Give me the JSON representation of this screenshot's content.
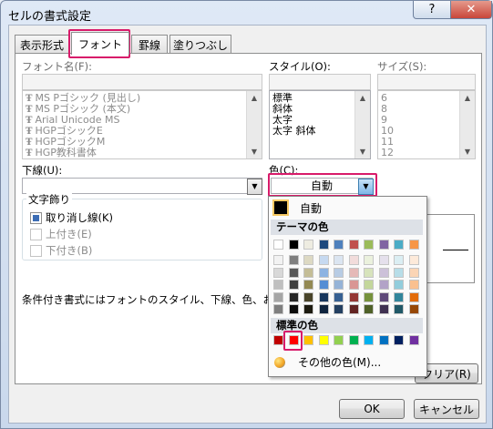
{
  "window": {
    "title": "セルの書式設定",
    "help": "?",
    "close": "✕"
  },
  "tabs": [
    {
      "label": "表示形式",
      "active": false
    },
    {
      "label": "フォント",
      "active": true
    },
    {
      "label": "罫線",
      "active": false
    },
    {
      "label": "塗りつぶし",
      "active": false
    }
  ],
  "font_name": {
    "label": "フォント名(F):",
    "value": "",
    "items": [
      "MS Pゴシック (見出し)",
      "MS Pゴシック (本文)",
      "Arial Unicode MS",
      "HGPゴシックE",
      "HGPゴシックM",
      "HGP教科書体"
    ]
  },
  "style": {
    "label": "スタイル(O):",
    "value": "",
    "items": [
      "標準",
      "斜体",
      "太字",
      "太字 斜体"
    ]
  },
  "size": {
    "label": "サイズ(S):",
    "value": "",
    "items": [
      "6",
      "8",
      "9",
      "10",
      "11",
      "12"
    ]
  },
  "underline": {
    "label": "下線(U):",
    "value": ""
  },
  "color": {
    "label": "色(C):",
    "value": "自動"
  },
  "effects": {
    "title": "文字飾り",
    "strikethrough": {
      "label": "取り消し線(K)",
      "checked": true
    },
    "superscript": {
      "label": "上付き(E)",
      "checked": false
    },
    "subscript": {
      "label": "下付き(B)",
      "checked": false
    }
  },
  "note": "条件付き書式にはフォントのスタイル、下線、色、および取り",
  "buttons": {
    "clear": "クリア(R)",
    "ok": "OK",
    "cancel": "キャンセル"
  },
  "color_menu": {
    "auto_label": "自動",
    "theme_header": "テーマの色",
    "standard_header": "標準の色",
    "more_label": "その他の色(M)...",
    "theme_base": [
      "#ffffff",
      "#000000",
      "#eeece1",
      "#1f497d",
      "#4f81bd",
      "#c0504d",
      "#9bbb59",
      "#8064a2",
      "#4bacc6",
      "#f79646"
    ],
    "theme_shades": [
      [
        "#f2f2f2",
        "#7f7f7f",
        "#ddd9c3",
        "#c6d9f0",
        "#dbe5f1",
        "#f2dcdb",
        "#ebf1dd",
        "#e5e0ec",
        "#dbeef3",
        "#fdeada"
      ],
      [
        "#d8d8d8",
        "#595959",
        "#c4bd97",
        "#8db3e2",
        "#b8cce4",
        "#e5b9b7",
        "#d7e3bc",
        "#ccc1d9",
        "#b7dde8",
        "#fbd5b5"
      ],
      [
        "#bfbfbf",
        "#3f3f3f",
        "#938953",
        "#548dd4",
        "#95b3d7",
        "#d99694",
        "#c3d69b",
        "#b2a2c7",
        "#92cddc",
        "#fac08f"
      ],
      [
        "#a5a5a5",
        "#262626",
        "#494429",
        "#17365d",
        "#366092",
        "#953734",
        "#76923c",
        "#5f497a",
        "#31859b",
        "#e36c09"
      ],
      [
        "#7f7f7f",
        "#0c0c0c",
        "#1d1b10",
        "#0f243e",
        "#244061",
        "#632423",
        "#4f6128",
        "#3f3151",
        "#205867",
        "#974806"
      ]
    ],
    "standard": [
      "#c00000",
      "#ff0000",
      "#ffc000",
      "#ffff00",
      "#92d050",
      "#00b050",
      "#00b0f0",
      "#0070c0",
      "#002060",
      "#7030a0"
    ]
  }
}
